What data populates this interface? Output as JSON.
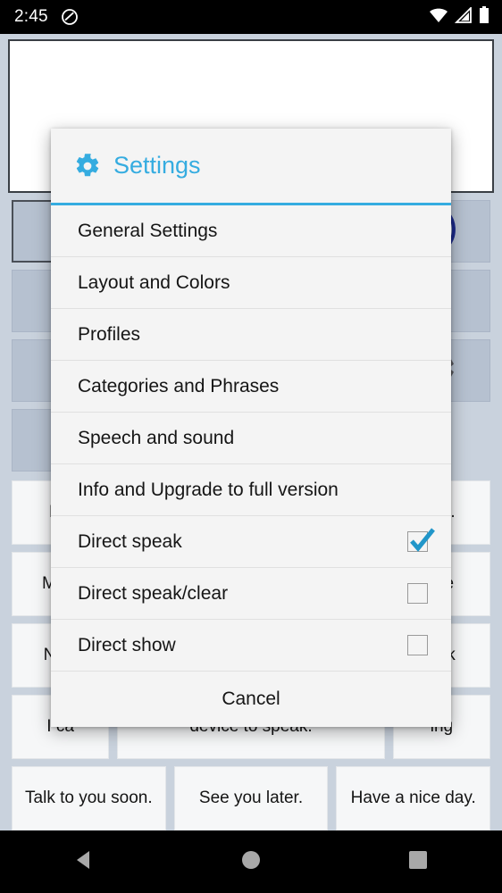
{
  "status_bar": {
    "time": "2:45",
    "dnd_icon": "do-not-disturb-icon",
    "wifi_icon": "wifi-icon",
    "signal_icon": "cell-signal-icon",
    "battery_icon": "battery-full-icon"
  },
  "app": {
    "text_input_value": "",
    "text_input_placeholder": "",
    "categories": [
      {
        "label": "",
        "selected": true
      },
      {
        "label": "",
        "selected": false
      },
      {
        "label": "",
        "selected": false
      },
      {
        "label": "",
        "selected": false
      }
    ],
    "controls": [
      {
        "icon": "speaker-sound-icon",
        "color": "#1c2a8c"
      },
      {
        "icon": "fullscreen-expand-icon",
        "color": "#39708f"
      },
      {
        "icon": "gear-icon",
        "color": "#56565a"
      }
    ],
    "phrase_rows": [
      {
        "cells": [
          {
            "text": "My",
            "wide": false
          },
          {
            "text": "",
            "wide": true
          },
          {
            "text": "s ...",
            "wide": false
          }
        ]
      },
      {
        "cells": [
          {
            "text": "My a",
            "wide": false
          },
          {
            "text": "",
            "wide": true
          },
          {
            "text": "are",
            "wide": false
          }
        ]
      },
      {
        "cells": [
          {
            "text": "Nice",
            "wide": false
          },
          {
            "text": "",
            "wide": true
          },
          {
            "text": "ank",
            "wide": false
          }
        ]
      },
      {
        "cells": [
          {
            "text": "I ca",
            "wide": false
          },
          {
            "text": "device to speak.",
            "wide": true
          },
          {
            "text": "ing",
            "wide": false
          }
        ]
      },
      {
        "cells": [
          {
            "text": "Talk to you soon.",
            "wide": false
          },
          {
            "text": "See you later.",
            "wide": false
          },
          {
            "text": "Have a nice day.",
            "wide": false
          }
        ]
      }
    ]
  },
  "dialog": {
    "title": "Settings",
    "title_icon": "gear-icon",
    "accent_color": "#35ace0",
    "items": [
      {
        "label": "General Settings",
        "type": "menu"
      },
      {
        "label": "Layout and Colors",
        "type": "menu"
      },
      {
        "label": "Profiles",
        "type": "menu"
      },
      {
        "label": "Categories and Phrases",
        "type": "menu"
      },
      {
        "label": "Speech and sound",
        "type": "menu"
      },
      {
        "label": "Info and Upgrade to full version",
        "type": "menu"
      },
      {
        "label": "Direct speak",
        "type": "checkbox",
        "checked": true
      },
      {
        "label": "Direct speak/clear",
        "type": "checkbox",
        "checked": false
      },
      {
        "label": "Direct show",
        "type": "checkbox",
        "checked": false
      }
    ],
    "cancel_label": "Cancel"
  },
  "nav_bar": {
    "back_icon": "back-triangle-icon",
    "home_icon": "home-circle-icon",
    "recents_icon": "recents-square-icon"
  }
}
